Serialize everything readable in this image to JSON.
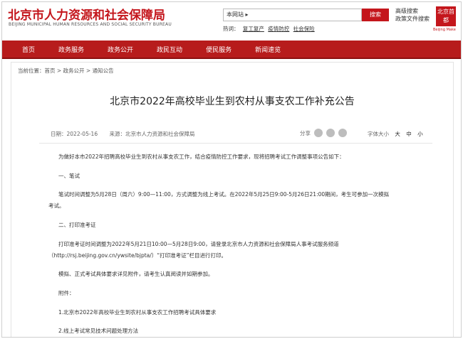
{
  "header": {
    "logo_cn": "北京市人力资源和社会保障局",
    "logo_en": "BEIJING MUNICIPAL HUMAN RESOURCES AND SOCIAL SECURITY BUREAU",
    "search_scope": "本网站 ▸",
    "search_placeholder": "",
    "search_button": "搜索",
    "advanced_search": "高级搜索",
    "policy_search": "政策文件搜索",
    "hot_label": "热词：",
    "hot_items": [
      "复工复产",
      "疫情防控",
      "社会保险"
    ],
    "seal_text": "北京首都",
    "seal_sub": "Beijing  Make"
  },
  "nav": {
    "items": [
      "首页",
      "政务服务",
      "政务公开",
      "政民互动",
      "便民服务",
      "新闻速览"
    ]
  },
  "breadcrumb": {
    "label": "当前位置：",
    "trail": "首页 > 政务公开 > 通知公告"
  },
  "article": {
    "title": "北京市2022年高校毕业生到农村从事支农工作补充公告",
    "date": "日期：2022-05-16",
    "source": "来源：北京市人力资源和社会保障局",
    "share_label": "分享",
    "fontsize_label": "字体大小",
    "fontsize_large": "大",
    "fontsize_medium": "中",
    "fontsize_small": "小",
    "paragraphs": [
      "为做好本市2022年招聘高校毕业生到农村从事支农工作，结合疫情防控工作要求，现将招聘考试工作调整事项公告如下：",
      "一、笔试",
      "笔试时间调整为5月28日（周六）9:00—11:00，方式调整为线上考试。在2022年5月25日9:00-5月26日21:00期间，考生可参加一次模拟",
      "考试。",
      "二、打印准考证",
      "打印准考证时间调整为2022年5月21日10:00—5月28日9:00，请登录北京市人力资源和社会保障局人事考试服务频道",
      "（http://rsj.beijing.gov.cn/ywsite/bjpta/）“打印准考证”栏目进行打印。",
      "模拟、正式考试具体要求详见附件，请考生认真阅读并如期参加。",
      "附件：",
      "1.北京市2022年高校毕业生到农村从事支农工作招聘考试具体要求",
      "2.线上考试常见技术问题处理方法"
    ]
  },
  "colors": {
    "brand_red": "#c4161c",
    "nav_red": "#b71c1c"
  }
}
